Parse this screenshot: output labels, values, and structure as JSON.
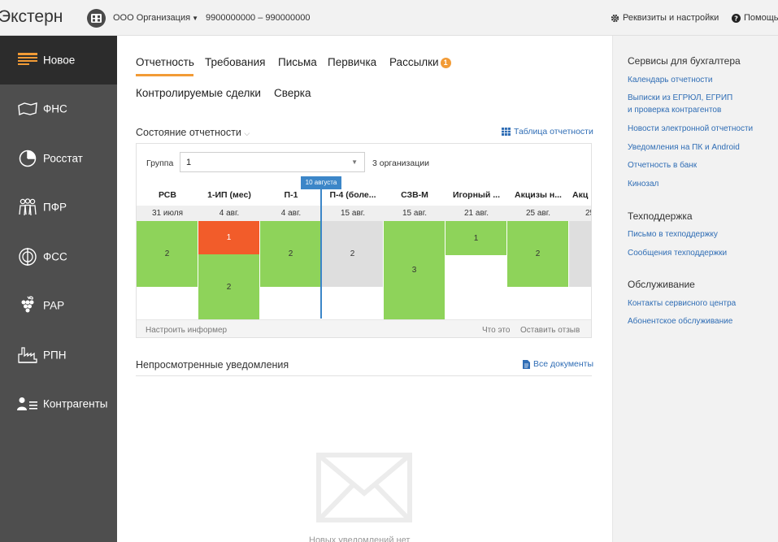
{
  "app": {
    "title": "Экстерн"
  },
  "header": {
    "org_name": "ООО Организация",
    "inn_kpp": "9900000000 – 990000000",
    "settings_label": "Реквизиты и настройки",
    "help_label": "Помощь"
  },
  "sidebar": {
    "items": [
      {
        "label": "Новое",
        "icon": "news-icon"
      },
      {
        "label": "ФНС",
        "icon": "fns-map-icon"
      },
      {
        "label": "Росстат",
        "icon": "pie-chart-icon"
      },
      {
        "label": "ПФР",
        "icon": "people-icon"
      },
      {
        "label": "ФСС",
        "icon": "fss-icon"
      },
      {
        "label": "РАР",
        "icon": "grapes-icon"
      },
      {
        "label": "РПН",
        "icon": "factory-icon"
      },
      {
        "label": "Контрагенты",
        "icon": "contractors-icon"
      }
    ]
  },
  "tabs": [
    {
      "label": "Отчетность"
    },
    {
      "label": "Требования"
    },
    {
      "label": "Письма"
    },
    {
      "label": "Первичка"
    },
    {
      "label": "Рассылки",
      "badge": "1"
    },
    {
      "label": "Контролируемые сделки"
    },
    {
      "label": "Сверка"
    }
  ],
  "informer": {
    "title": "Состояние отчетности",
    "table_link": "Таблица отчетности",
    "group_label": "Группа",
    "group_value": "1",
    "org_count": "3 организации",
    "today_label": "10 августа",
    "columns": [
      {
        "name": "РСВ",
        "date": "31 июля"
      },
      {
        "name": "1-ИП (мес)",
        "date": "4 авг."
      },
      {
        "name": "П-1",
        "date": "4 авг."
      },
      {
        "name": "П-4 (боле...",
        "date": "15 авг."
      },
      {
        "name": "СЗВ-М",
        "date": "15 авг."
      },
      {
        "name": "Игорный ...",
        "date": "21 авг."
      },
      {
        "name": "Акцизы н...",
        "date": "25 авг."
      },
      {
        "name": "Акц",
        "date": "25"
      }
    ],
    "cells": {
      "rsv_green": "2",
      "ip_red": "1",
      "ip_green": "2",
      "p1_green": "2",
      "p4_gray": "2",
      "szv_green": "3",
      "igor_green": "1",
      "akciz_green": "2"
    },
    "footer_configure": "Настроить информер",
    "footer_what": "Что это",
    "footer_feedback": "Оставить отзыв"
  },
  "notifications": {
    "title": "Непросмотренные уведомления",
    "all_docs": "Все документы",
    "empty_text": "Новых уведомлений нет"
  },
  "right_panel": {
    "sections": [
      {
        "title": "Сервисы для бухгалтера",
        "links": [
          "Календарь отчетности",
          "Выписки из ЕГРЮЛ, ЕГРИП",
          "и проверка контрагентов",
          "Новости электронной отчетности",
          "Уведомления на ПК и Android",
          "Отчетность в банк",
          "Кинозал"
        ]
      },
      {
        "title": "Техподдержка",
        "links": [
          "Письмо в техподдержку",
          "Сообщения техподдержки"
        ]
      },
      {
        "title": "Обслуживание",
        "links": [
          "Контакты сервисного центра",
          "Абонентское обслуживание"
        ]
      }
    ]
  },
  "colors": {
    "accent": "#f29b36",
    "link": "#2f6db5",
    "green": "#8ed35a",
    "red": "#f25c2a",
    "gray": "#dedede",
    "sidebar": "#4e4e4e",
    "sidebar_active": "#2c2c2c",
    "today": "#3c86c8"
  }
}
